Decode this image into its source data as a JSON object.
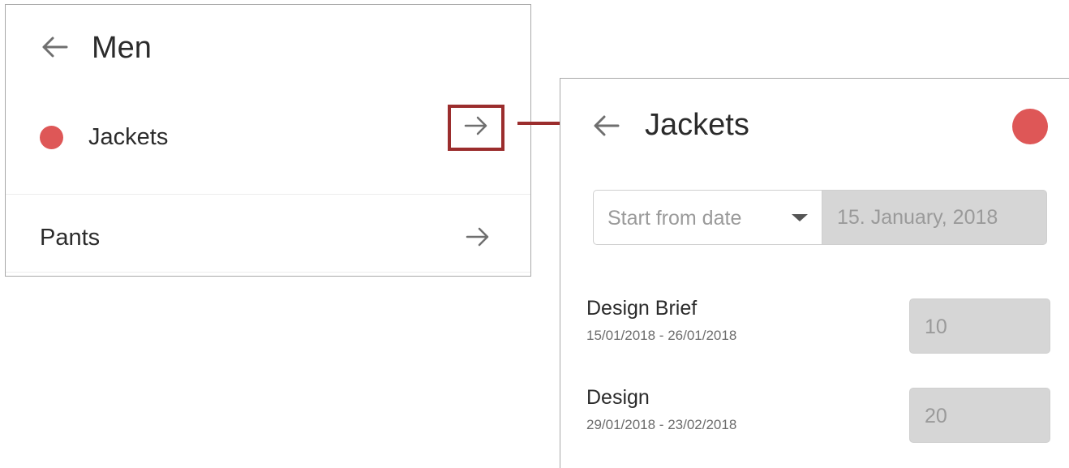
{
  "men_panel": {
    "title": "Men",
    "back_icon": "arrow-left-icon",
    "items": [
      {
        "label": "Jackets",
        "has_dot": true,
        "dot_color": "#de5757",
        "arrow_icon": "arrow-right-icon",
        "highlighted": true
      },
      {
        "label": "Pants",
        "has_dot": false,
        "arrow_icon": "arrow-right-icon",
        "highlighted": false
      }
    ]
  },
  "connector": {
    "color": "#9b2d2d",
    "icon": "arrow-right-icon"
  },
  "jackets_panel": {
    "title": "Jackets",
    "back_icon": "arrow-left-icon",
    "status_dot_color": "#de5757",
    "date_select": {
      "label": "Start from date",
      "caret_icon": "caret-down-icon"
    },
    "date_value": "15. January, 2018",
    "tasks": [
      {
        "name": "Design Brief",
        "dates": "15/01/2018 - 26/01/2018",
        "value": "10"
      },
      {
        "name": "Design",
        "dates": "29/01/2018 - 23/02/2018",
        "value": "20"
      }
    ]
  },
  "colors": {
    "accent_red": "#de5757",
    "highlight_border": "#9b2d2d",
    "disabled_field": "#d6d6d6"
  }
}
